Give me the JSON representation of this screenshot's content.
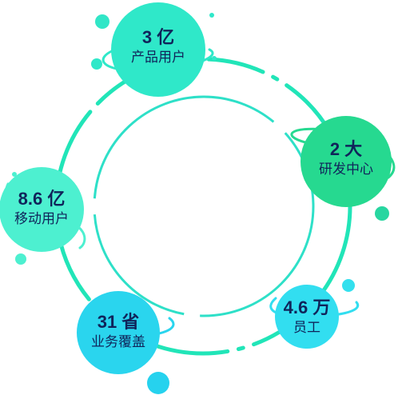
{
  "colors": {
    "ring": "#21e5b8",
    "inner_ring": "#2ee0c8",
    "text": "#10245a",
    "teal": "#2fe8c9",
    "cyan": "#32def0",
    "green": "#26d990",
    "mint": "#4df0d0",
    "sky": "#2ad5ee"
  },
  "stats": [
    {
      "id": "product-users",
      "value": "3 亿",
      "label": "产品用户",
      "color": "teal"
    },
    {
      "id": "rd-centers",
      "value": "2 大",
      "label": "研发中心",
      "color": "green"
    },
    {
      "id": "employees",
      "value": "4.6 万",
      "label": "员工",
      "color": "cyan"
    },
    {
      "id": "province-coverage",
      "value": "31 省",
      "label": "业务覆盖",
      "color": "sky"
    },
    {
      "id": "mobile-users",
      "value": "8.6 亿",
      "label": "移动用户",
      "color": "mint"
    }
  ]
}
